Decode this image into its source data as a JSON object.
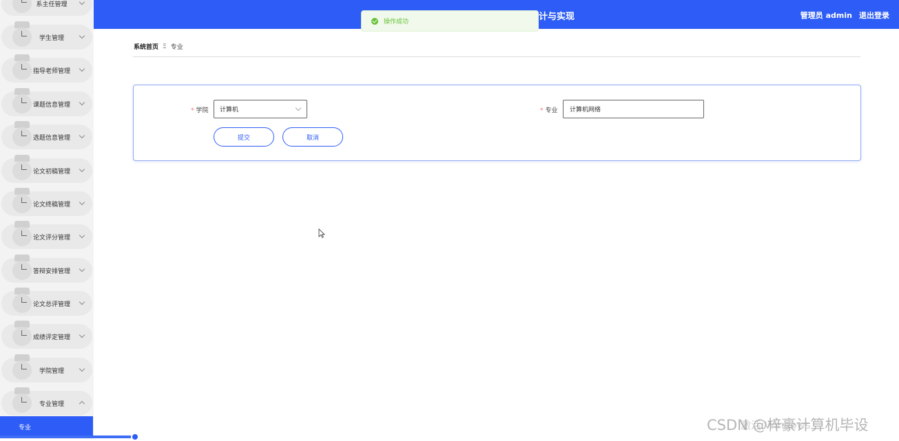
{
  "header": {
    "title": "计与实现",
    "user": "管理员 admin",
    "logout": "退出登录"
  },
  "toast": {
    "message": "操作成功"
  },
  "sidebar": {
    "items": [
      {
        "label": "系主任管理"
      },
      {
        "label": "学生管理"
      },
      {
        "label": "指导老师管理"
      },
      {
        "label": "课题信息管理"
      },
      {
        "label": "选题信息管理"
      },
      {
        "label": "论文初稿管理"
      },
      {
        "label": "论文终稿管理"
      },
      {
        "label": "论文评分管理"
      },
      {
        "label": "答辩安排管理"
      },
      {
        "label": "论文总评管理"
      },
      {
        "label": "成绩评定管理"
      },
      {
        "label": "学院管理"
      },
      {
        "label": "专业管理"
      }
    ],
    "active_sub": "专业"
  },
  "breadcrumb": {
    "home": "系统首页",
    "separator": "Ξ",
    "current": "专业"
  },
  "form": {
    "college_label": "学院",
    "college_value": "计算机",
    "major_label": "专业",
    "major_value": "计算机网络",
    "required_mark": "*",
    "submit_label": "提交",
    "cancel_label": "取消"
  },
  "watermark": {
    "line1": "CSDN @梓豪计算机毕设",
    "line2": "激活 Windows"
  },
  "colors": {
    "primary": "#2d5cf6",
    "success": "#67c23a",
    "required": "#f56c6c"
  }
}
